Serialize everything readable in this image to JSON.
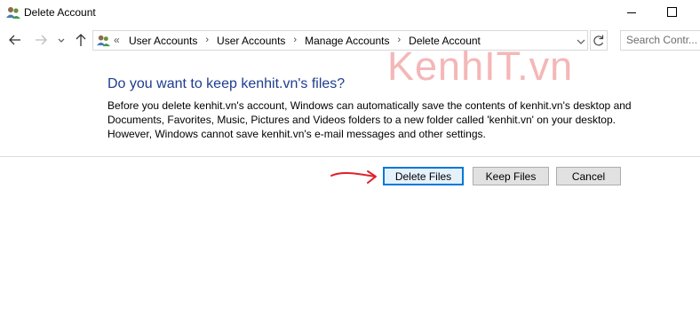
{
  "window": {
    "title": "Delete Account",
    "app_icon": "user-accounts-icon"
  },
  "navigation": {
    "back_icon": "back-arrow-icon",
    "forward_icon": "forward-arrow-icon",
    "recent_icon": "chevron-down-icon",
    "up_icon": "up-arrow-icon",
    "address": {
      "location_icon": "user-accounts-icon",
      "overflow": "«",
      "breadcrumbs": [
        "User Accounts",
        "User Accounts",
        "Manage Accounts",
        "Delete Account"
      ],
      "separator": "›"
    },
    "search": {
      "placeholder": "Search Contr..."
    }
  },
  "watermark": "KenhIT.vn",
  "content": {
    "heading": "Do you want to keep kenhit.vn's files?",
    "description": "Before you delete kenhit.vn's account, Windows can automatically save the contents of kenhit.vn's desktop and Documents, Favorites, Music, Pictures and Videos folders to a new folder called 'kenhit.vn' on your desktop. However, Windows cannot save kenhit.vn's e-mail messages and other settings."
  },
  "buttons": {
    "delete_files": "Delete Files",
    "keep_files": "Keep Files",
    "cancel": "Cancel"
  },
  "colors": {
    "heading": "#1e3d8f",
    "focus_border": "#0078d7",
    "annotation_arrow": "#e0202a",
    "watermark": "#f2a6a6"
  }
}
